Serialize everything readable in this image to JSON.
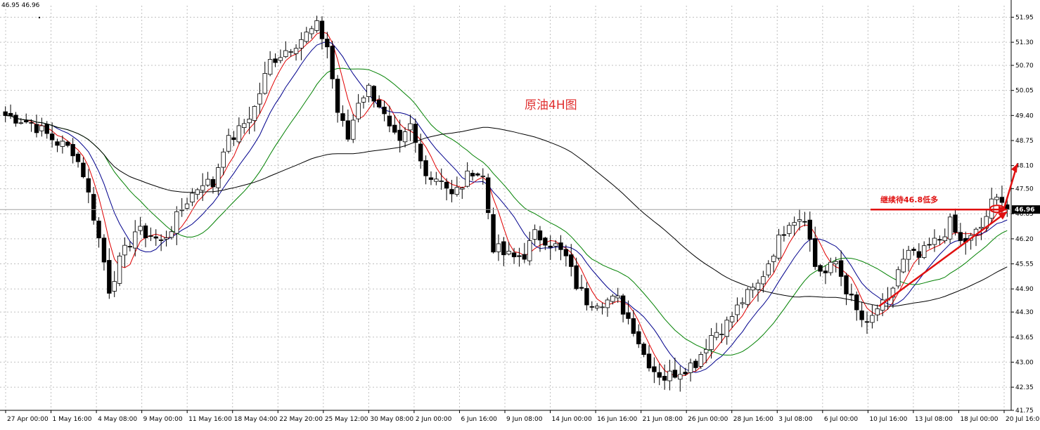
{
  "header": {
    "ohlc_text": "46.95 46.96"
  },
  "chart_data": {
    "type": "candlestick",
    "title": "原油4H图",
    "xlabel": "",
    "ylabel": "",
    "ylim": [
      41.75,
      52.25
    ],
    "grid": true,
    "y_ticks": [
      "51.95",
      "51.30",
      "50.70",
      "50.05",
      "49.40",
      "48.75",
      "48.10",
      "47.50",
      "46.85",
      "46.20",
      "45.55",
      "44.90",
      "44.30",
      "43.65",
      "43.00",
      "42.35",
      "41.75"
    ],
    "x_ticks": [
      "27 Apr 00:00",
      "1 May 16:00",
      "4 May 08:00",
      "9 May 00:00",
      "11 May 16:00",
      "18 May 04:00",
      "22 May 20:00",
      "25 May 12:00",
      "30 May 08:00",
      "2 Jun 00:00",
      "6 Jun 16:00",
      "9 Jun 08:00",
      "14 Jun 00:00",
      "16 Jun 16:00",
      "21 Jun 08:00",
      "26 Jun 00:00",
      "28 Jun 16:00",
      "3 Jul 08:00",
      "6 Jul 00:00",
      "10 Jul 16:00",
      "13 Jul 08:00",
      "18 Jul 00:00",
      "20 Jul 16:00"
    ],
    "current_price": 46.96,
    "current_price_label": "46.96",
    "horizontal_line": 46.96,
    "annotation": "继续待46.8低多",
    "close_path": [
      [
        0,
        49.4
      ],
      [
        3,
        49.3
      ],
      [
        5,
        49.2
      ],
      [
        7,
        49.0
      ],
      [
        10,
        48.7
      ],
      [
        13,
        48.5
      ],
      [
        15,
        47.9
      ],
      [
        17,
        46.8
      ],
      [
        19,
        45.6
      ],
      [
        20,
        44.9
      ],
      [
        22,
        45.6
      ],
      [
        25,
        46.4
      ],
      [
        28,
        46.3
      ],
      [
        30,
        46.1
      ],
      [
        32,
        46.5
      ],
      [
        35,
        47.2
      ],
      [
        38,
        47.7
      ],
      [
        40,
        47.6
      ],
      [
        42,
        48.6
      ],
      [
        45,
        49.0
      ],
      [
        48,
        49.6
      ],
      [
        51,
        50.8
      ],
      [
        54,
        51.1
      ],
      [
        57,
        51.4
      ],
      [
        60,
        51.7
      ],
      [
        62,
        51.2
      ],
      [
        64,
        49.5
      ],
      [
        66,
        48.8
      ],
      [
        68,
        49.8
      ],
      [
        70,
        50.1
      ],
      [
        72,
        49.7
      ],
      [
        74,
        49.0
      ],
      [
        76,
        48.6
      ],
      [
        78,
        49.1
      ],
      [
        80,
        48.2
      ],
      [
        82,
        47.8
      ],
      [
        84,
        47.8
      ],
      [
        86,
        47.3
      ],
      [
        88,
        47.6
      ],
      [
        90,
        48.0
      ],
      [
        92,
        47.8
      ],
      [
        94,
        46.0
      ],
      [
        96,
        45.8
      ],
      [
        98,
        45.7
      ],
      [
        100,
        45.8
      ],
      [
        102,
        46.3
      ],
      [
        104,
        46.2
      ],
      [
        106,
        46.0
      ],
      [
        108,
        45.7
      ],
      [
        110,
        45.0
      ],
      [
        112,
        44.6
      ],
      [
        115,
        44.6
      ],
      [
        118,
        44.6
      ],
      [
        121,
        43.9
      ],
      [
        123,
        43.2
      ],
      [
        125,
        42.8
      ],
      [
        127,
        42.6
      ],
      [
        130,
        42.8
      ],
      [
        133,
        43.0
      ],
      [
        136,
        43.7
      ],
      [
        139,
        44.0
      ],
      [
        142,
        44.6
      ],
      [
        145,
        45.0
      ],
      [
        148,
        45.9
      ],
      [
        151,
        46.7
      ],
      [
        154,
        46.8
      ],
      [
        156,
        45.5
      ],
      [
        158,
        45.3
      ],
      [
        160,
        45.6
      ],
      [
        162,
        44.9
      ],
      [
        164,
        44.3
      ],
      [
        166,
        43.9
      ],
      [
        168,
        44.4
      ],
      [
        170,
        44.5
      ],
      [
        172,
        45.4
      ],
      [
        174,
        45.8
      ],
      [
        176,
        45.7
      ],
      [
        178,
        46.0
      ],
      [
        180,
        46.2
      ],
      [
        182,
        46.6
      ],
      [
        184,
        46.1
      ],
      [
        186,
        46.2
      ],
      [
        188,
        46.5
      ],
      [
        190,
        47.1
      ],
      [
        192,
        47.3
      ],
      [
        193,
        46.96
      ]
    ],
    "series": [
      {
        "color": "#e00000",
        "values": []
      },
      {
        "color": "#00008c",
        "values": []
      },
      {
        "color": "#008000",
        "values": []
      },
      {
        "color": "#000000",
        "values": []
      }
    ]
  },
  "colors": {
    "bull": "#ffffff",
    "bear": "#000000",
    "grid": "#c0c0c0",
    "accent": "#e01010",
    "axis_bg": "#ffffff",
    "label_bg": "#000000"
  }
}
